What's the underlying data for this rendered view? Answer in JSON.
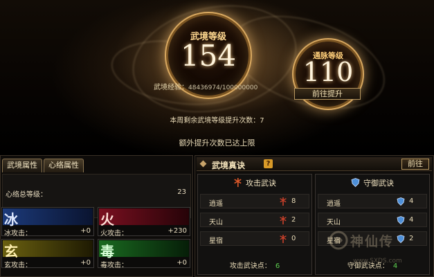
{
  "scene": {
    "wujing_title": "武境等级",
    "wujing_level": "154",
    "tongmai_title": "通脉等级",
    "tongmai_level": "110",
    "exp_label": "武境经验：",
    "exp_value": "48436974/100000000",
    "goto_label": "前往提升",
    "weekly_text": "本周剩余武境等级提升次数：7",
    "extra_text": "额外提升次数已达上限"
  },
  "left_panel": {
    "tabs": [
      "武境属性",
      "心络属性"
    ],
    "active_tab": 1,
    "total_label": "心络总等级：",
    "total_value": "23",
    "elements": [
      {
        "glyph": "冰",
        "label": "冰攻击：",
        "value": "+0",
        "color": "#1c3a7a"
      },
      {
        "glyph": "火",
        "label": "火攻击：",
        "value": "+230",
        "color": "#7a1020"
      },
      {
        "glyph": "玄",
        "label": "玄攻击：",
        "value": "+0",
        "color": "#6a6010"
      },
      {
        "glyph": "毒",
        "label": "毒攻击：",
        "value": "+0",
        "color": "#1a6a20"
      }
    ]
  },
  "right_panel": {
    "title": "武境真诀",
    "help": "?",
    "goto_label": "前往",
    "attack": {
      "title": "攻击武诀",
      "icon": "sword-icon",
      "rows": [
        {
          "name": "逍遥",
          "value": "8"
        },
        {
          "name": "天山",
          "value": "2"
        },
        {
          "name": "星宿",
          "value": "0"
        }
      ],
      "points_label": "攻击武诀点：",
      "points_value": "6"
    },
    "defense": {
      "title": "守御武诀",
      "icon": "shield-icon",
      "rows": [
        {
          "name": "逍遥",
          "value": "4"
        },
        {
          "name": "天山",
          "value": "4"
        },
        {
          "name": "星宿",
          "value": "2"
        }
      ],
      "points_label": "守御武诀点：",
      "points_value": "4"
    }
  },
  "watermark": {
    "text": "神仙传",
    "url": "www.SXDS.com"
  },
  "colors": {
    "accent_gold": "#d8a860",
    "points_green": "#5ed050",
    "help_orange": "#d89a28"
  }
}
